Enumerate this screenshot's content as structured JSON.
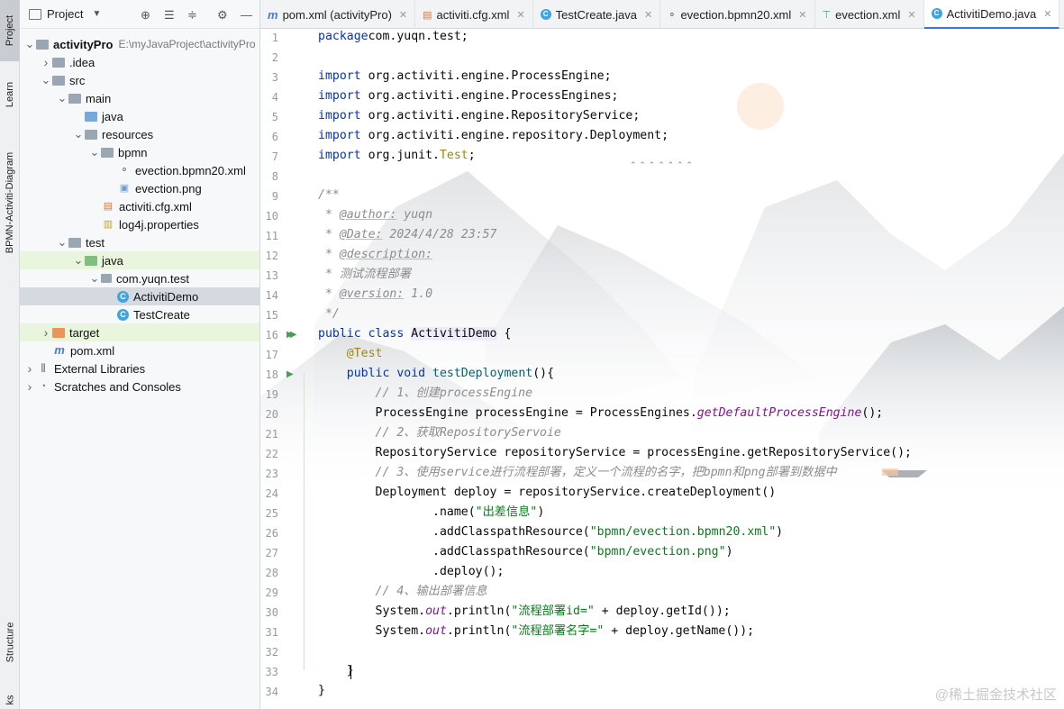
{
  "left_strip": {
    "tabs": [
      "Project",
      "Learn",
      "BPMN-Activiti-Diagram",
      "Structure",
      "ks"
    ]
  },
  "project_panel": {
    "title": "Project",
    "tree": [
      {
        "label": "activityPro",
        "extra": "E:\\myJavaProject\\activityPro",
        "depth": 0,
        "arrow": "down",
        "icon": "module-folder-icon",
        "bold": true
      },
      {
        "label": ".idea",
        "depth": 1,
        "arrow": "right",
        "icon": "folder-icon"
      },
      {
        "label": "src",
        "depth": 1,
        "arrow": "down",
        "icon": "folder-icon"
      },
      {
        "label": "main",
        "depth": 2,
        "arrow": "down",
        "icon": "folder-icon"
      },
      {
        "label": "java",
        "depth": 3,
        "arrow": "",
        "icon": "source-folder-icon"
      },
      {
        "label": "resources",
        "depth": 3,
        "arrow": "down",
        "icon": "resources-folder-icon"
      },
      {
        "label": "bpmn",
        "depth": 4,
        "arrow": "down",
        "icon": "folder-icon"
      },
      {
        "label": "evection.bpmn20.xml",
        "depth": 5,
        "arrow": "",
        "icon": "bpmn-file-icon"
      },
      {
        "label": "evection.png",
        "depth": 5,
        "arrow": "",
        "icon": "image-file-icon"
      },
      {
        "label": "activiti.cfg.xml",
        "depth": 4,
        "arrow": "",
        "icon": "xml-file-icon"
      },
      {
        "label": "log4j.properties",
        "depth": 4,
        "arrow": "",
        "icon": "properties-file-icon"
      },
      {
        "label": "test",
        "depth": 2,
        "arrow": "down",
        "icon": "folder-icon"
      },
      {
        "label": "java",
        "depth": 3,
        "arrow": "down",
        "icon": "test-folder-icon",
        "highlight": true
      },
      {
        "label": "com.yuqn.test",
        "depth": 4,
        "arrow": "down",
        "icon": "package-icon"
      },
      {
        "label": "ActivitiDemo",
        "depth": 5,
        "arrow": "",
        "icon": "java-class-icon",
        "selected": true
      },
      {
        "label": "TestCreate",
        "depth": 5,
        "arrow": "",
        "icon": "java-class-icon"
      },
      {
        "label": "target",
        "depth": 1,
        "arrow": "right",
        "icon": "excluded-folder-icon",
        "highlight": true
      },
      {
        "label": "pom.xml",
        "depth": 1,
        "arrow": "",
        "icon": "maven-icon"
      },
      {
        "label": "External Libraries",
        "depth": 0,
        "arrow": "right",
        "icon": "libraries-icon"
      },
      {
        "label": "Scratches and Consoles",
        "depth": 0,
        "arrow": "right",
        "icon": "scratches-icon"
      }
    ]
  },
  "tabs": [
    {
      "label": "pom.xml (activityPro)",
      "icon": "maven-icon",
      "active": false
    },
    {
      "label": "activiti.cfg.xml",
      "icon": "xml-file-icon",
      "active": false
    },
    {
      "label": "TestCreate.java",
      "icon": "java-class-icon",
      "active": false
    },
    {
      "label": "evection.bpmn20.xml",
      "icon": "bpmn-file-icon",
      "active": false
    },
    {
      "label": "evection.xml",
      "icon": "diagram-icon",
      "active": false
    },
    {
      "label": "ActivitiDemo.java",
      "icon": "java-class-icon",
      "active": true
    }
  ],
  "code_lines": [
    {
      "n": "1",
      "parts": [
        [
          "kw",
          "package"
        ],
        [
          "",
          "com.yuqn.test;"
        ]
      ]
    },
    {
      "n": "2",
      "parts": []
    },
    {
      "n": "3",
      "parts": [
        [
          "kw",
          "import "
        ],
        [
          "",
          "org.activiti.engine.ProcessEngine;"
        ]
      ]
    },
    {
      "n": "4",
      "parts": [
        [
          "kw",
          "import "
        ],
        [
          "",
          "org.activiti.engine.ProcessEngines;"
        ]
      ]
    },
    {
      "n": "5",
      "parts": [
        [
          "kw",
          "import "
        ],
        [
          "",
          "org.activiti.engine.RepositoryService;"
        ]
      ]
    },
    {
      "n": "6",
      "parts": [
        [
          "kw",
          "import "
        ],
        [
          "",
          "org.activiti.engine.repository.Deployment;"
        ]
      ]
    },
    {
      "n": "7",
      "parts": [
        [
          "kw",
          "import "
        ],
        [
          "",
          "org.junit."
        ],
        [
          "ann",
          "Test"
        ],
        [
          "",
          ";"
        ]
      ]
    },
    {
      "n": "8",
      "parts": []
    },
    {
      "n": "9",
      "parts": [
        [
          "cm",
          "/**"
        ]
      ]
    },
    {
      "n": "10",
      "parts": [
        [
          "cm",
          " * "
        ],
        [
          "tag",
          "@author:"
        ],
        [
          "cm",
          " yuqn"
        ]
      ]
    },
    {
      "n": "11",
      "parts": [
        [
          "cm",
          " * "
        ],
        [
          "tag",
          "@Date:"
        ],
        [
          "cm",
          " 2024/4/28 23:57"
        ]
      ]
    },
    {
      "n": "12",
      "parts": [
        [
          "cm",
          " * "
        ],
        [
          "tag",
          "@description:"
        ]
      ]
    },
    {
      "n": "13",
      "parts": [
        [
          "cm",
          " * 测试流程部署"
        ]
      ]
    },
    {
      "n": "14",
      "parts": [
        [
          "cm",
          " * "
        ],
        [
          "tag",
          "@version:"
        ],
        [
          "cm",
          " 1.0"
        ]
      ]
    },
    {
      "n": "15",
      "parts": [
        [
          "cm",
          " */"
        ]
      ]
    },
    {
      "n": "16",
      "parts": [
        [
          "kw",
          "public class "
        ],
        [
          "hlname",
          "ActivitiDemo"
        ],
        [
          "",
          " {"
        ]
      ]
    },
    {
      "n": "17",
      "parts": [
        [
          "",
          "    "
        ],
        [
          "ann",
          "@Test"
        ]
      ]
    },
    {
      "n": "18",
      "parts": [
        [
          "",
          "    "
        ],
        [
          "kw",
          "public void "
        ],
        [
          "fn",
          "testDeployment"
        ],
        [
          "",
          "(){"
        ]
      ]
    },
    {
      "n": "19",
      "parts": [
        [
          "",
          "        "
        ],
        [
          "cm",
          "// 1、创建processEngine"
        ]
      ]
    },
    {
      "n": "20",
      "parts": [
        [
          "",
          "        ProcessEngine processEngine = ProcessEngines."
        ],
        [
          "sm",
          "getDefaultProcessEngine"
        ],
        [
          "",
          "();"
        ]
      ]
    },
    {
      "n": "21",
      "parts": [
        [
          "",
          "        "
        ],
        [
          "cm",
          "// 2、获取RepositoryServoie"
        ]
      ]
    },
    {
      "n": "22",
      "parts": [
        [
          "",
          "        RepositoryService repositoryService = processEngine.getRepositoryService();"
        ]
      ]
    },
    {
      "n": "23",
      "parts": [
        [
          "",
          "        "
        ],
        [
          "cm",
          "// 3、使用service进行流程部署，定义一个流程的名字，把bpmn和png部署到数据中"
        ]
      ]
    },
    {
      "n": "24",
      "parts": [
        [
          "",
          "        Deployment deploy = repositoryService.createDeployment()"
        ]
      ]
    },
    {
      "n": "25",
      "parts": [
        [
          "",
          "                .name("
        ],
        [
          "str",
          "\"出差信息\""
        ],
        [
          "",
          ")"
        ]
      ]
    },
    {
      "n": "26",
      "parts": [
        [
          "",
          "                .addClasspathResource("
        ],
        [
          "str",
          "\"bpmn/evection.bpmn20.xml\""
        ],
        [
          "",
          ")"
        ]
      ]
    },
    {
      "n": "27",
      "parts": [
        [
          "",
          "                .addClasspathResource("
        ],
        [
          "str",
          "\"bpmn/evection.png\""
        ],
        [
          "",
          ")"
        ]
      ]
    },
    {
      "n": "28",
      "parts": [
        [
          "",
          "                .deploy();"
        ]
      ]
    },
    {
      "n": "29",
      "parts": [
        [
          "",
          "        "
        ],
        [
          "cm",
          "// 4、输出部署信息"
        ]
      ]
    },
    {
      "n": "30",
      "parts": [
        [
          "",
          "        System."
        ],
        [
          "sm",
          "out"
        ],
        [
          "",
          ".println("
        ],
        [
          "str",
          "\"流程部署id=\""
        ],
        [
          "",
          " + deploy.getId());"
        ]
      ]
    },
    {
      "n": "31",
      "parts": [
        [
          "",
          "        System."
        ],
        [
          "sm",
          "out"
        ],
        [
          "",
          ".println("
        ],
        [
          "str",
          "\"流程部署名字=\""
        ],
        [
          "",
          " + deploy.getName());"
        ]
      ]
    },
    {
      "n": "32",
      "parts": []
    },
    {
      "n": "33",
      "parts": [
        [
          "",
          "    }"
        ]
      ]
    },
    {
      "n": "34",
      "parts": [
        [
          "",
          "}"
        ]
      ]
    }
  ],
  "watermark": "@稀土掘金技术社区"
}
